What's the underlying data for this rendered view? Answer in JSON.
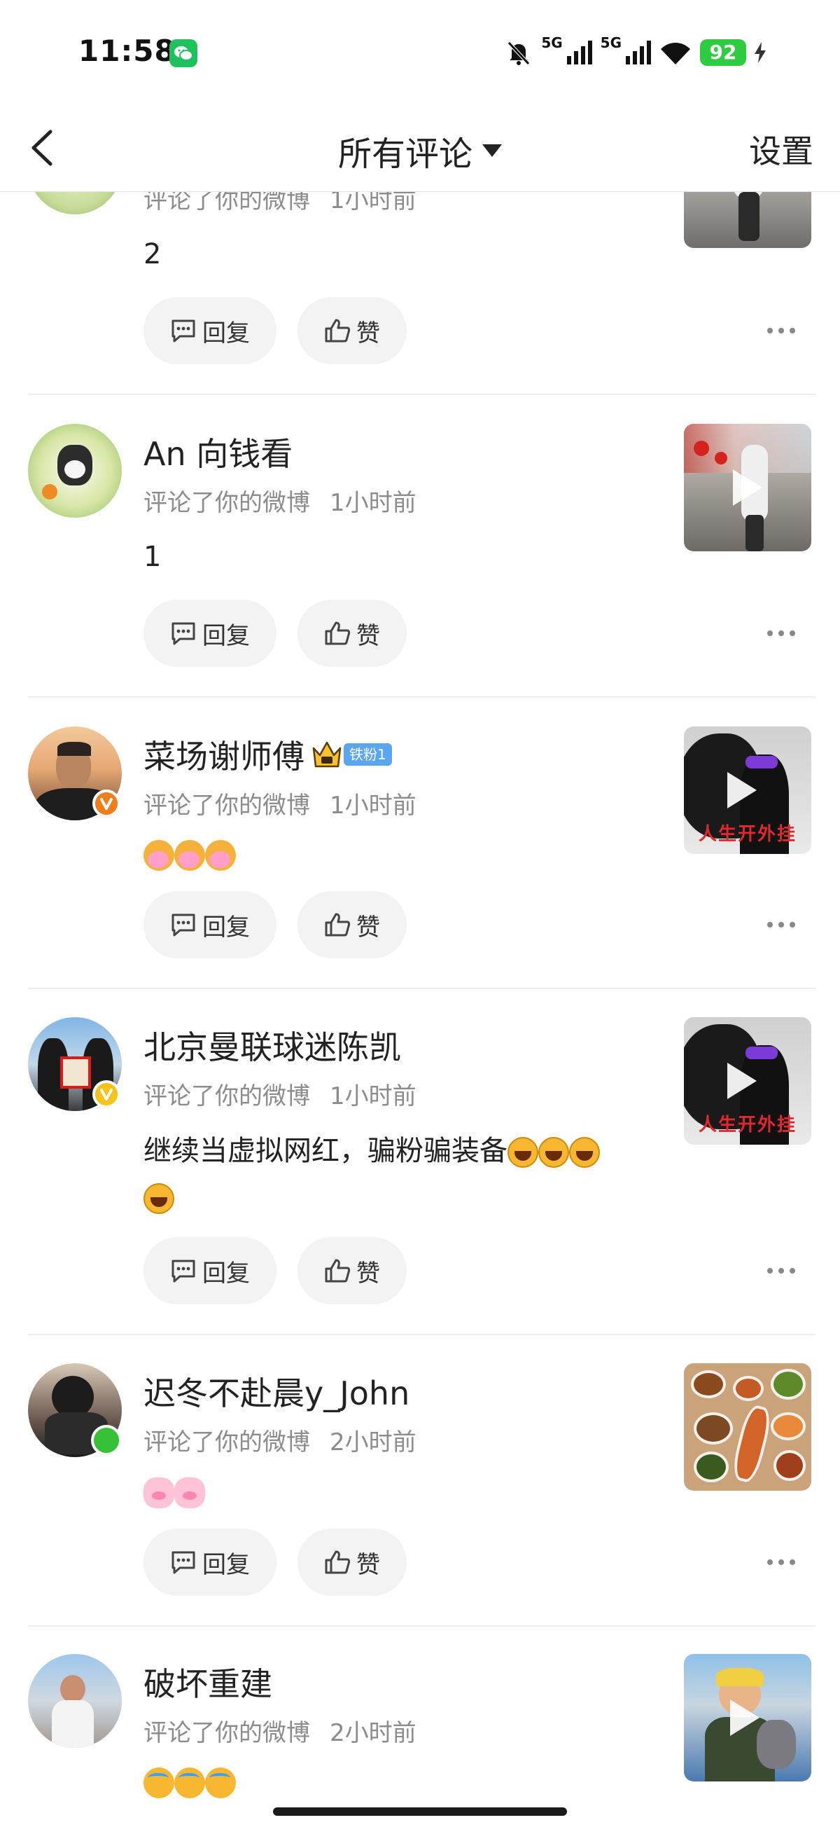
{
  "status_bar": {
    "time": "11:58",
    "network_1": "5G",
    "network_2": "5G",
    "battery": "92",
    "accent_green": "#2ecc40"
  },
  "nav": {
    "title": "所有评论",
    "settings": "设置"
  },
  "actions": {
    "reply": "回复",
    "like": "赞"
  },
  "comments": [
    {
      "name": "",
      "action": "评论了你的微博",
      "time": "1小时前",
      "content": "2"
    },
    {
      "name": "An 向钱看",
      "action": "评论了你的微博",
      "time": "1小时前",
      "content": "1"
    },
    {
      "name": "菜场谢师傅",
      "fan_badge": "铁粉1",
      "action": "评论了你的微博",
      "time": "1小时前",
      "content": "",
      "thumb_caption": "人生开外挂"
    },
    {
      "name": "北京曼联球迷陈凯",
      "action": "评论了你的微博",
      "time": "1小时前",
      "content": "继续当虚拟网红，骗粉骗装备",
      "thumb_caption": "人生开外挂"
    },
    {
      "name": "迟冬不赴晨y_John",
      "action": "评论了你的微博",
      "time": "2小时前",
      "content": ""
    },
    {
      "name": "破坏重建",
      "action": "评论了你的微博",
      "time": "2小时前",
      "content": ""
    }
  ]
}
